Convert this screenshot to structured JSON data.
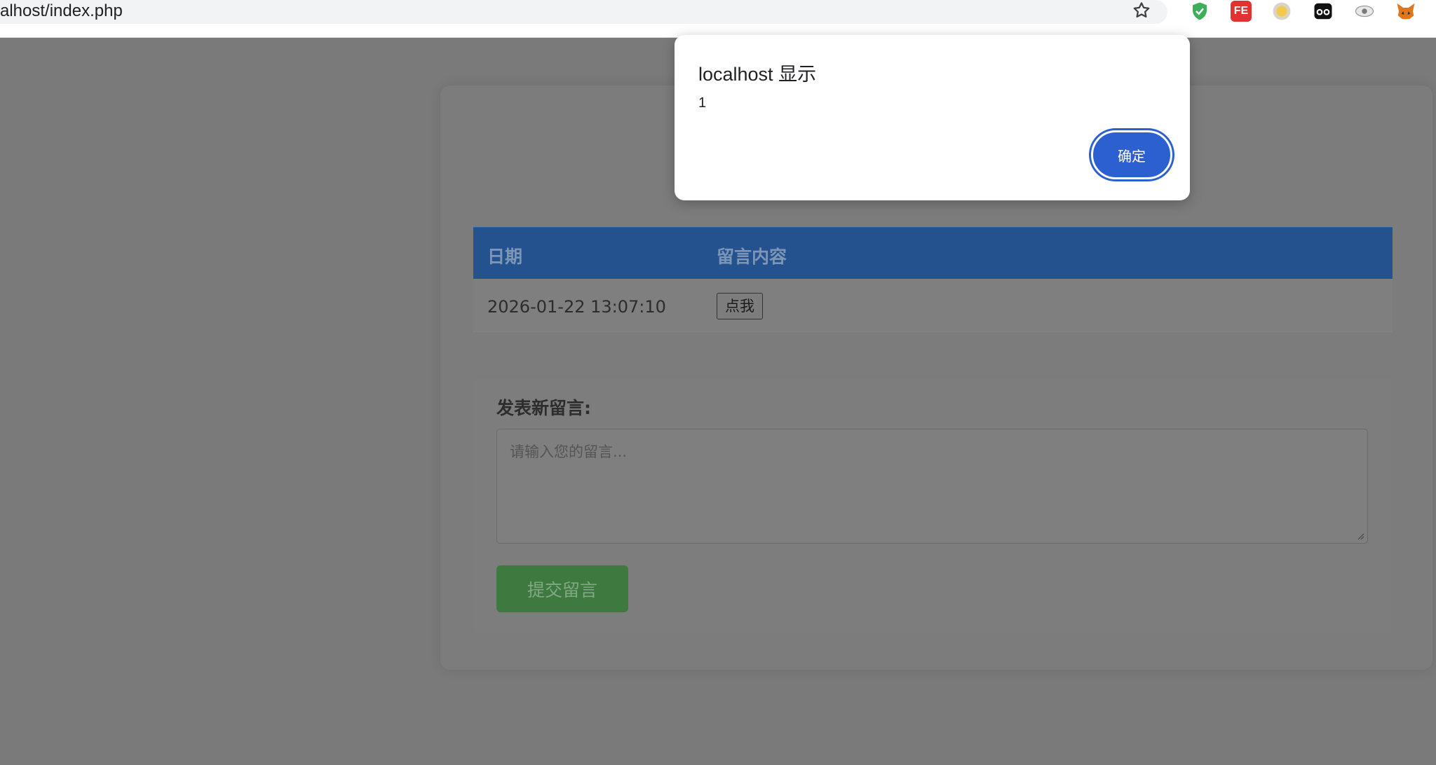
{
  "browser": {
    "url": "alhost/index.php",
    "extensions": [
      "shield-check-icon",
      "fe-helper-icon",
      "circle-extension-icon",
      "mask-extension-icon",
      "eye-extension-icon",
      "fox-extension-icon"
    ],
    "fe_label": "FE"
  },
  "dialog": {
    "title": "localhost 显示",
    "message": "1",
    "ok_label": "确定"
  },
  "table": {
    "headers": [
      "日期",
      "留言内容"
    ],
    "rows": [
      {
        "date": "2026-01-22 13:07:10",
        "content_button": "点我"
      }
    ]
  },
  "form": {
    "label": "发表新留言:",
    "placeholder": "请输入您的留言...",
    "submit_label": "提交留言"
  },
  "colors": {
    "table_header": "#23528f",
    "submit_button": "#3e7a40",
    "dialog_button": "#2c5fd0",
    "overlay_background": "#7a7a7a"
  }
}
